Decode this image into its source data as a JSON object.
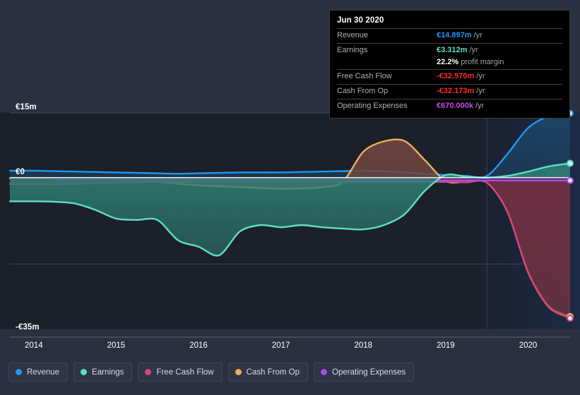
{
  "chart_data": {
    "type": "area",
    "title": "",
    "xlabel": "",
    "ylabel": "",
    "currency": "EUR",
    "xlim": [
      2013.71,
      2020.51
    ],
    "ylim": [
      -35,
      15
    ],
    "grid": true,
    "legend_position": "bottom-left",
    "y_ticks": [
      {
        "value": 15,
        "label": "€15m"
      },
      {
        "value": 0,
        "label": "€0"
      },
      {
        "value": -35,
        "label": "-€35m"
      }
    ],
    "x_ticks": [
      {
        "value": 2014,
        "label": "2014"
      },
      {
        "value": 2015,
        "label": "2015"
      },
      {
        "value": 2016,
        "label": "2016"
      },
      {
        "value": 2017,
        "label": "2017"
      },
      {
        "value": 2018,
        "label": "2018"
      },
      {
        "value": 2019,
        "label": "2019"
      },
      {
        "value": 2020,
        "label": "2020"
      }
    ],
    "forecast_start": 2019.5,
    "x": [
      2013.71,
      2014.0,
      2014.25,
      2014.5,
      2014.75,
      2015.0,
      2015.25,
      2015.5,
      2015.75,
      2016.0,
      2016.25,
      2016.5,
      2016.75,
      2017.0,
      2017.25,
      2017.5,
      2017.75,
      2018.0,
      2018.25,
      2018.5,
      2018.75,
      2019.0,
      2019.25,
      2019.5,
      2019.75,
      2020.0,
      2020.25,
      2020.51
    ],
    "series": [
      {
        "name": "Revenue",
        "color": "#2196f3",
        "fill": "#1d4668",
        "values": [
          1.6,
          1.6,
          1.5,
          1.4,
          1.3,
          1.2,
          1.1,
          1.0,
          0.9,
          1.0,
          1.1,
          1.2,
          1.2,
          1.2,
          1.3,
          1.4,
          1.5,
          1.6,
          1.5,
          1.2,
          0.9,
          0.6,
          0.4,
          0.4,
          5.5,
          11.5,
          14.2,
          14.897
        ]
      },
      {
        "name": "Earnings",
        "color": "#5ce0c0",
        "fill": "#2f7e74",
        "values": [
          -5.5,
          -5.5,
          -5.6,
          -6.0,
          -7.5,
          -9.5,
          -9.8,
          -9.8,
          -14.5,
          -16.0,
          -18.0,
          -12.5,
          -11.0,
          -11.5,
          -11.0,
          -11.5,
          -11.8,
          -12.0,
          -11.0,
          -8.5,
          -3.0,
          0.6,
          0.2,
          0.0,
          0.4,
          1.4,
          2.6,
          3.312
        ]
      },
      {
        "name": "Free Cash Flow",
        "color": "#d6447a",
        "fill": "#6e2b42",
        "values": [
          -1.5,
          -1.5,
          -1.5,
          -1.4,
          -1.3,
          -1.2,
          -1.1,
          -1.0,
          -1.0,
          -1.0,
          -1.0,
          -1.0,
          -1.0,
          -1.0,
          -1.0,
          -1.0,
          -1.0,
          -1.0,
          -1.0,
          -1.0,
          -1.0,
          -1.0,
          -1.1,
          -1.2,
          -8.0,
          -22.0,
          -30.0,
          -32.57
        ]
      },
      {
        "name": "Cash From Op",
        "color": "#e8b060",
        "fill": "#6e4540",
        "values": [
          -0.2,
          -0.2,
          -0.3,
          -0.4,
          -0.5,
          -0.6,
          -0.8,
          -1.0,
          -1.4,
          -1.8,
          -2.0,
          -2.2,
          -2.4,
          -2.6,
          -2.5,
          -2.2,
          -1.0,
          6.0,
          8.4,
          8.5,
          4.0,
          -0.8,
          -1.0,
          -1.1,
          -7.8,
          -21.8,
          -29.8,
          -32.173
        ]
      },
      {
        "name": "Operating Expenses",
        "color": "#a64ce8",
        "fill": "#4c2a6e",
        "values": [
          null,
          null,
          -0.6,
          -0.6,
          -0.6,
          -0.6,
          -0.6,
          -0.6,
          -0.6,
          -0.6,
          -0.6,
          -0.6,
          -0.62,
          -0.62,
          -0.62,
          -0.63,
          -0.63,
          -0.64,
          -0.64,
          -0.65,
          -0.65,
          -0.66,
          -0.66,
          -0.66,
          -0.67,
          -0.67,
          -0.67,
          -0.67
        ]
      }
    ]
  },
  "tooltip": {
    "title": "Jun 30 2020",
    "rows": [
      {
        "label": "Revenue",
        "value": "€14.897m",
        "unit": "/yr",
        "color": "#2196f3"
      },
      {
        "label": "Earnings",
        "value": "€3.312m",
        "unit": "/yr",
        "color": "#5ce0c0"
      },
      {
        "label": "",
        "value": "22.2%",
        "unit": "profit margin",
        "color": "#ffffff"
      },
      {
        "label": "Free Cash Flow",
        "value": "-€32.570m",
        "unit": "/yr",
        "color": "#ff2d2d"
      },
      {
        "label": "Cash From Op",
        "value": "-€32.173m",
        "unit": "/yr",
        "color": "#ff2d2d"
      },
      {
        "label": "Operating Expenses",
        "value": "€670.000k",
        "unit": "/yr",
        "color": "#c44ce8"
      }
    ]
  },
  "legend": {
    "items": [
      {
        "label": "Revenue",
        "color": "#2196f3"
      },
      {
        "label": "Earnings",
        "color": "#5ce0c0"
      },
      {
        "label": "Free Cash Flow",
        "color": "#d6447a"
      },
      {
        "label": "Cash From Op",
        "color": "#e8b060"
      },
      {
        "label": "Operating Expenses",
        "color": "#a64ce8"
      }
    ]
  }
}
